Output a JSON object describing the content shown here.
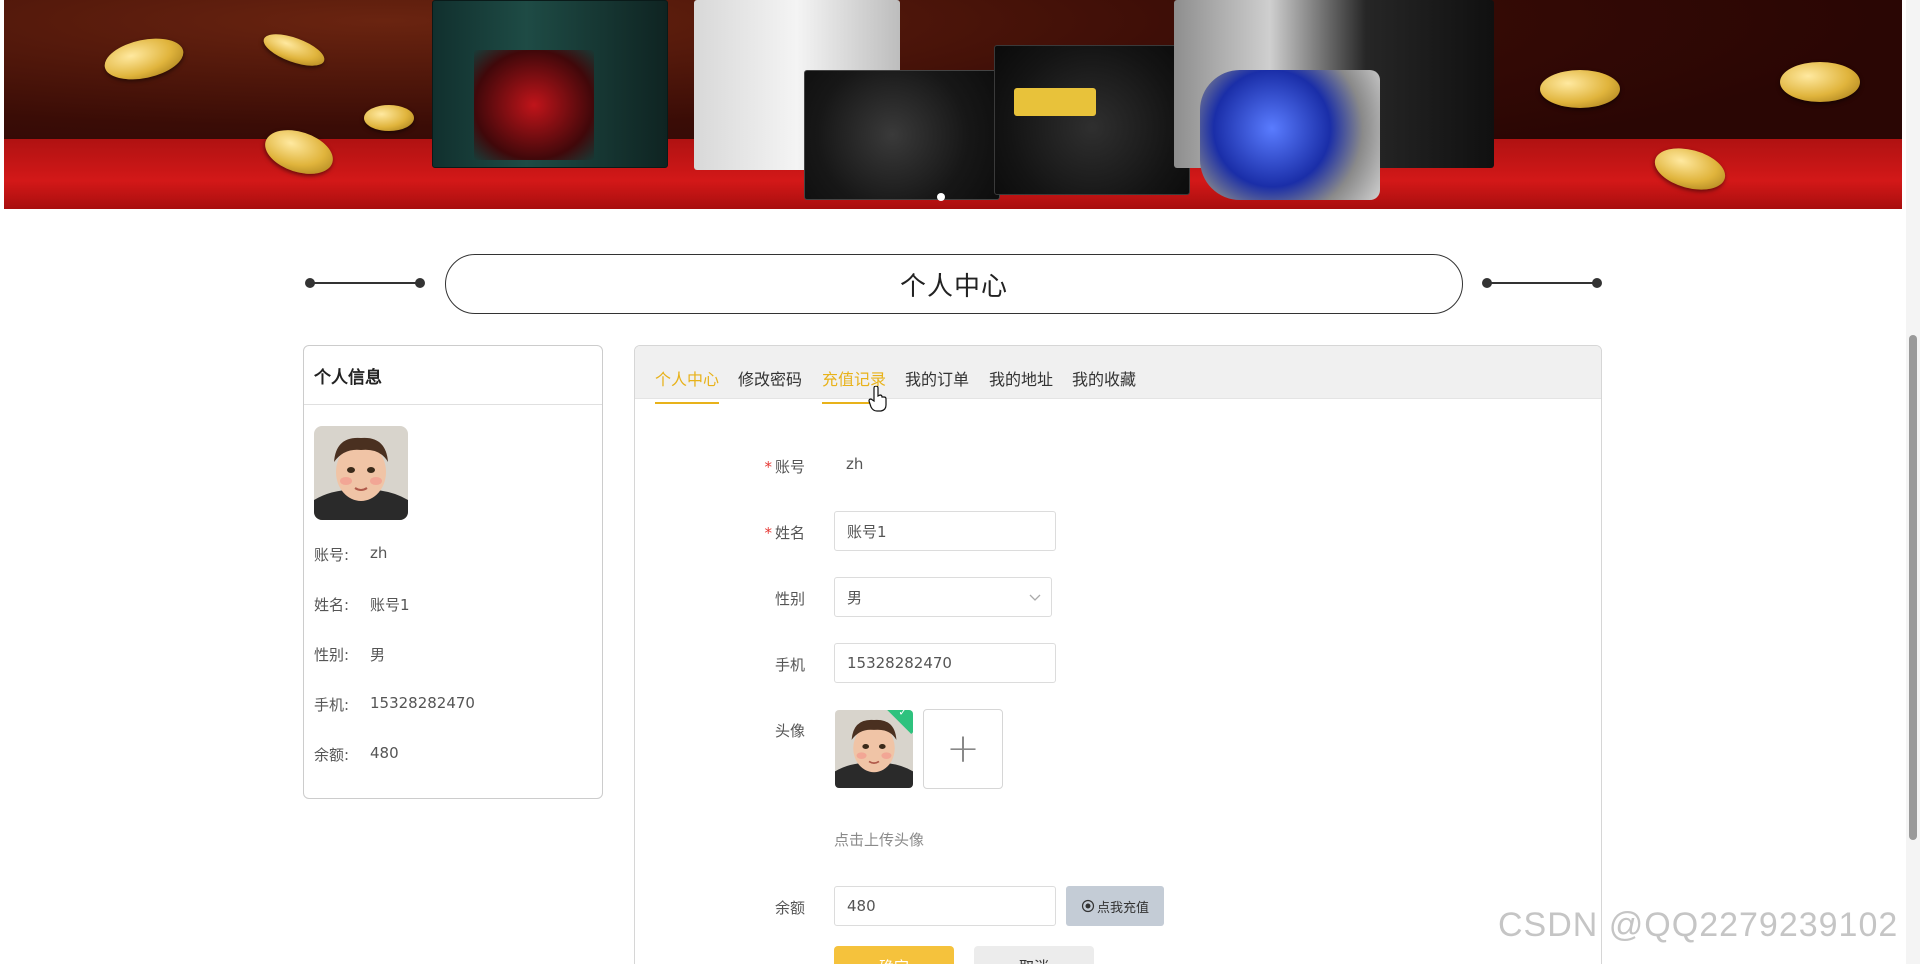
{
  "section_title": "个人中心",
  "left_card": {
    "title": "个人信息",
    "rows": [
      {
        "label": "账号:",
        "value": "zh"
      },
      {
        "label": "姓名:",
        "value": "账号1"
      },
      {
        "label": "性别:",
        "value": "男"
      },
      {
        "label": "手机:",
        "value": "15328282470"
      },
      {
        "label": "余额:",
        "value": "480"
      }
    ]
  },
  "tabs": [
    {
      "label": "个人中心",
      "active": true
    },
    {
      "label": "修改密码",
      "active": false
    },
    {
      "label": "充值记录",
      "active": false
    },
    {
      "label": "我的订单",
      "active": false
    },
    {
      "label": "我的地址",
      "active": false
    },
    {
      "label": "我的收藏",
      "active": false
    }
  ],
  "form": {
    "account": {
      "label": "账号",
      "value": "zh",
      "required": true
    },
    "name": {
      "label": "姓名",
      "value": "账号1",
      "required": true
    },
    "gender": {
      "label": "性别",
      "value": "男"
    },
    "phone": {
      "label": "手机",
      "value": "15328282470"
    },
    "avatar": {
      "label": "头像",
      "hint": "点击上传头像",
      "add_symbol": "+"
    },
    "balance": {
      "label": "余额",
      "value": "480",
      "recharge_label": "点我充值"
    },
    "submit_label": "确定",
    "cancel_label": "取消"
  },
  "watermark": "CSDN @QQ2279239102",
  "colors": {
    "accent": "#e8b21a",
    "required": "#e53935",
    "success_badge": "#2ec27e"
  }
}
